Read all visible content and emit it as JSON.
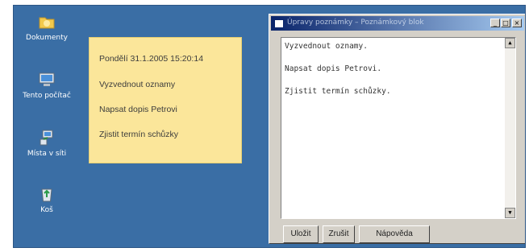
{
  "desktop": {
    "icons": [
      {
        "label": "Dokumenty",
        "icon": "folder-icon"
      },
      {
        "label": "Tento počítač",
        "icon": "computer-icon"
      },
      {
        "label": "Místa v síti",
        "icon": "network-places-icon"
      },
      {
        "label": "Koš",
        "icon": "recycle-bin-icon"
      }
    ]
  },
  "note": {
    "timestamp": "Pondělí 31.1.2005 15:20:14",
    "items": [
      "Vyzvednout oznamy",
      "Napsat dopis Petrovi",
      "Zjistit termín schůzky"
    ]
  },
  "window": {
    "title": "Úpravy poznámky – Poznámkový blok",
    "lines": [
      "Vyzvednout oznamy.",
      "Napsat dopis Petrovi.",
      "Zjistit termín schůzky."
    ],
    "buttons": {
      "save": "Uložit",
      "cancel": "Zrušit",
      "help": "Nápověda"
    },
    "controls": {
      "minimize": "_",
      "maximize": "□",
      "close": "×"
    }
  },
  "colors": {
    "desktop": "#3a6ea5",
    "note": "#fbe69a",
    "window": "#d4d0c8",
    "titlebar": "#0a246a"
  }
}
